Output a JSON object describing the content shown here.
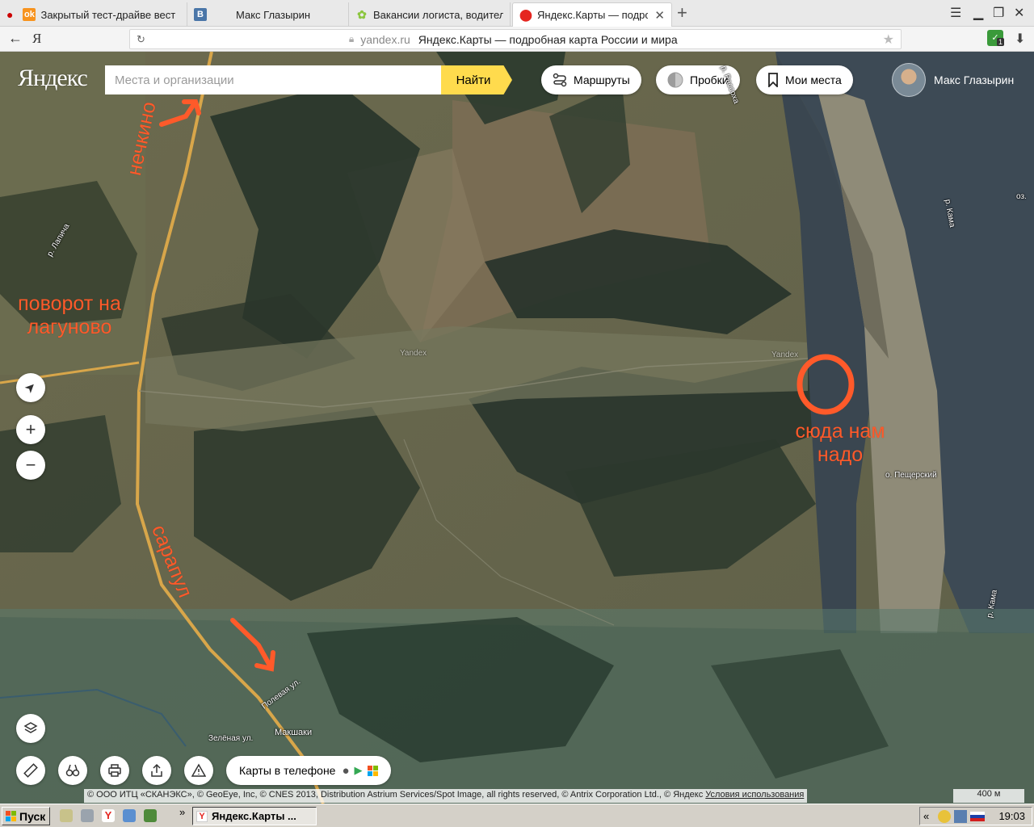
{
  "browser": {
    "tabs": [
      {
        "title": "Закрытый тест-драйве вест",
        "favicon": "odnoklassniki-icon",
        "color": "#f7931e"
      },
      {
        "title": "Макс Глазырин",
        "favicon": "vk-icon",
        "color": "#4a76a8"
      },
      {
        "title": "Вакансии логиста, водител",
        "favicon": "headhunter-icon",
        "color": "#8cc63f"
      },
      {
        "title": "Яндекс.Карты — подробн",
        "favicon": "yandex-maps-icon",
        "color": "#e52620",
        "active": true
      }
    ],
    "new_tab": "+",
    "url_domain": "yandex.ru",
    "page_title": "Яндекс.Карты — подробная карта России и мира",
    "back_label": "←",
    "yandex_button": "Я",
    "ext_badge": "1"
  },
  "map": {
    "logo": "Яндекс",
    "search_placeholder": "Места и организации",
    "find_label": "Найти",
    "routes_label": "Маршруты",
    "traffic_label": "Пробки",
    "places_label": "Мои места",
    "user_name": "Макс Глазырин",
    "mobile_label": "Карты в телефоне",
    "copyright": "© ООО ИТЦ «СКАНЭКС», © GeoEye, Inc, © CNES 2013, Distribution Astrium Services/Spot Image, all rights reserved, © Antrix Corporation Ltd., © Яндекс",
    "terms_label": "Условия использования",
    "scale_label": "400 м",
    "annotations": {
      "nechkino": "нечкино",
      "turn": "поворот на лагуново",
      "here": "сюда нам надо",
      "sarapul": "сарапул"
    },
    "labels": {
      "lapicha": "р. Лапича",
      "rassokha": "р. Рассоха",
      "kama1": "р. Кама",
      "kama2": "р. Кама",
      "pesherskiy": "о. Пещерский",
      "polevaya": "Полевая ул.",
      "zelenaya": "Зелёная ул.",
      "makshaki": "Макшаки",
      "oz": "оз.",
      "watermark1": "Yandex",
      "watermark2": "Yandex"
    },
    "accent": "#ffdb4d",
    "annotation_color": "#ff5a2a"
  },
  "taskbar": {
    "start_label": "Пуск",
    "task_label": "Яндекс.Карты ...",
    "clock": "19:03",
    "chevron": "»",
    "tray_chevron": "«"
  }
}
